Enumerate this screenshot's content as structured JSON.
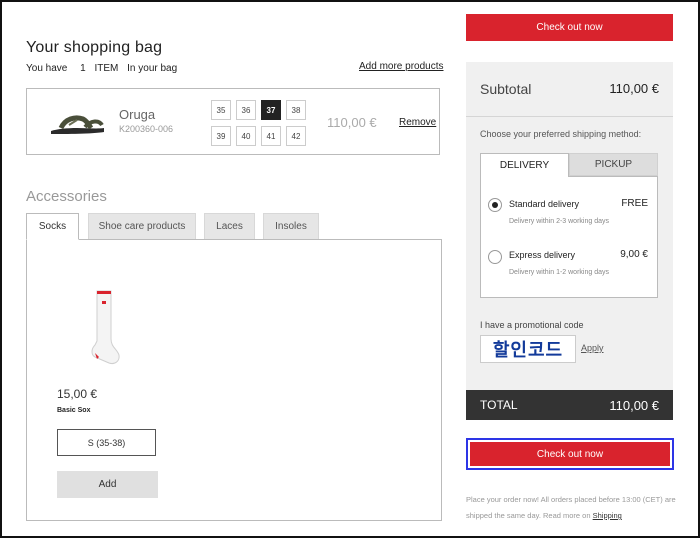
{
  "bag": {
    "title": "Your shopping bag",
    "you_have": "You have",
    "count": "1",
    "item_word": "ITEM",
    "in_bag": "In your bag",
    "add_more": "Add more products"
  },
  "item": {
    "name": "Oruga",
    "code": "K200360-006",
    "sizes": [
      "35",
      "36",
      "37",
      "38",
      "39",
      "40",
      "41",
      "42"
    ],
    "selected_size": "37",
    "price": "110,00 €",
    "remove": "Remove"
  },
  "accessories": {
    "title": "Accessories",
    "tabs": [
      "Socks",
      "Shoe care products",
      "Laces",
      "Insoles"
    ],
    "active_tab": "Socks",
    "product": {
      "price": "15,00 €",
      "name": "Basic Sox",
      "size": "S (35-38)",
      "add": "Add"
    }
  },
  "summary": {
    "checkout_label": "Check out now",
    "subtotal_label": "Subtotal",
    "subtotal_value": "110,00 €",
    "shipping_prompt": "Choose your preferred shipping method:",
    "shipping_tabs": [
      "DELIVERY",
      "PICKUP"
    ],
    "options": [
      {
        "name": "Standard delivery",
        "price": "FREE",
        "desc": "Delivery  within 2-3 working days",
        "selected": true
      },
      {
        "name": "Express delivery",
        "price": "9,00 €",
        "desc": "Delivery  within 1-2 working days",
        "selected": false
      }
    ],
    "promo_label": "I have a promotional code",
    "promo_value": "할인코드",
    "apply": "Apply",
    "total_label": "TOTAL",
    "total_value": "110,00 €",
    "note_text": "Place your order now! All orders placed before 13:00 (CET) are shipped the same day. Read more on",
    "note_link": "Shipping"
  },
  "colors": {
    "accent_red": "#d9232d",
    "highlight_blue": "#2d35e6",
    "total_bar": "#333333"
  }
}
